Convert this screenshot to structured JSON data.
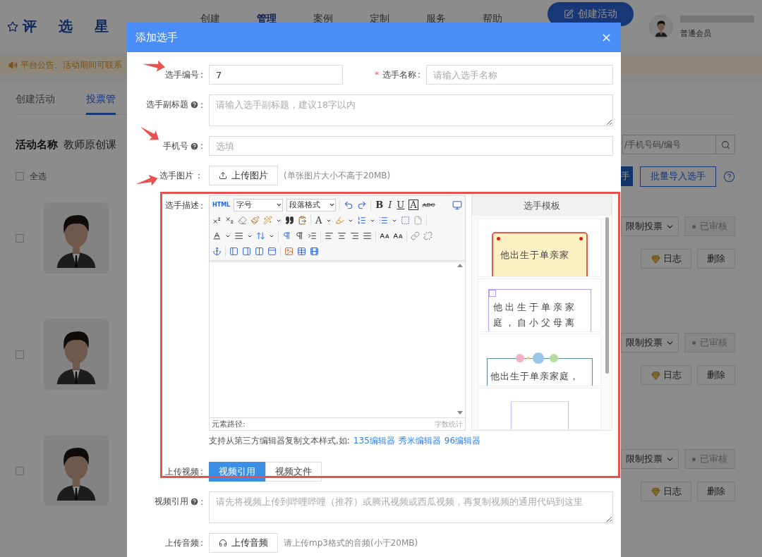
{
  "header": {
    "logo": "评 选 星",
    "nav": [
      {
        "label": "创建",
        "selected": false
      },
      {
        "label": "管理",
        "selected": true
      },
      {
        "label": "案例",
        "selected": false
      },
      {
        "label": "定制",
        "selected": false
      },
      {
        "label": "服务",
        "selected": false
      },
      {
        "label": "帮助",
        "selected": false
      }
    ],
    "create_button": "创建活动",
    "user_role": "普通会员"
  },
  "notice": "平台公告、活动期间可联系",
  "page_tabs": [
    {
      "label": "创建活动",
      "selected": false
    },
    {
      "label": "投票管",
      "selected": true
    }
  ],
  "activity": {
    "label": "活动名称",
    "name": "教师原创课"
  },
  "search": {
    "placeholder": "/手机号码/编号"
  },
  "select_all": {
    "label": "全选",
    "checked": false
  },
  "actions": {
    "add_button": "手",
    "import_button": "批量导入选手"
  },
  "contestants": [
    {
      "checked": false,
      "limit": "限制投票",
      "status": "已审核",
      "log": "日志",
      "delete": "删除"
    },
    {
      "checked": false,
      "limit": "限制投票",
      "status": "已审核",
      "log": "日志",
      "delete": "删除"
    },
    {
      "checked": false,
      "limit": "限制投票",
      "status": "已审核",
      "log": "日志",
      "delete": "删除"
    }
  ],
  "dialog": {
    "title": "添加选手",
    "number": {
      "label": "选手编号",
      "colon": ":",
      "value": "7"
    },
    "name": {
      "required_mark": "*",
      "label": "选手名称",
      "colon": ":",
      "placeholder": "请输入选手名称"
    },
    "subtitle": {
      "label": "选手副标题",
      "help": true,
      "colon": ":",
      "placeholder": "请输入选手副标题，建议18字以内"
    },
    "phone": {
      "label": "手机号",
      "help": true,
      "colon": ":",
      "placeholder": "选填"
    },
    "photo": {
      "label": "选手图片",
      "colon": "：",
      "button": "上传图片",
      "hint": "(单张图片大小不高于20MB)"
    },
    "description": {
      "label": "选手描述",
      "colon": ":",
      "toolbar": {
        "html": "HTML",
        "font_size": "字号",
        "paragraph": "段落格式",
        "bold": "B",
        "italic": "I",
        "underline": "U",
        "border": "A",
        "strike": "ABC",
        "font_color": "A"
      },
      "path_label": "元素路径:",
      "word_count": "字数统计",
      "templates": {
        "title": "选手模板",
        "cards": [
          {
            "kind": "note",
            "lines": [
              "他出生于单亲家"
            ]
          },
          {
            "kind": "frame",
            "lines": [
              "他出生于单亲家",
              "庭，自小父母离"
            ]
          },
          {
            "kind": "planets",
            "lines": [
              "他出生于单亲家庭，"
            ]
          },
          {
            "kind": "blank"
          }
        ]
      }
    },
    "paste_hint": {
      "text": "支持从第三方编辑器复制文本样式,如:",
      "links": [
        "135编辑器",
        "秀米编辑器",
        "96编辑器"
      ]
    },
    "video": {
      "label": "上传视频",
      "colon": ":",
      "tabs": [
        {
          "label": "视频引用",
          "selected": true
        },
        {
          "label": "视频文件",
          "selected": false
        }
      ]
    },
    "video_embed": {
      "label": "视频引用",
      "help": true,
      "colon": ":",
      "placeholder": "请先将视频上传到哔哩哔哩（推荐）或腾讯视频或西瓜视频，再复制视频的通用代码到这里"
    },
    "audio": {
      "label": "上传音频",
      "colon": ":",
      "button": "上传音频",
      "hint": "请上传mp3格式的音频(小于20MB)"
    }
  }
}
